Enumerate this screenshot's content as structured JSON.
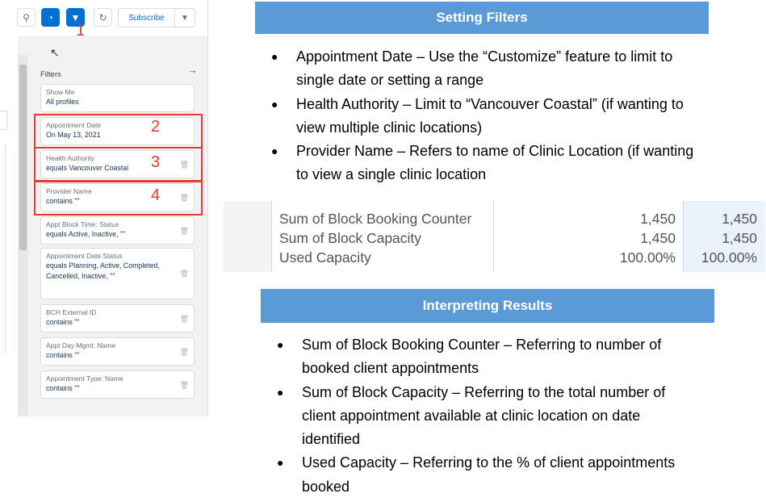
{
  "toolbar": {
    "subscribe_label": "Subscribe",
    "annotation_1": "1"
  },
  "filters_panel": {
    "title": "Filters",
    "cards": [
      {
        "title": "Show Me",
        "value": "All profiles"
      },
      {
        "title": "Appointment Date",
        "value": "On May 13, 2021",
        "annotation": "2"
      },
      {
        "title": "Health Authority",
        "value": "equals Vancouver Coastal",
        "annotation": "3"
      },
      {
        "title": "Provider Name",
        "value": "contains \"\"",
        "annotation": "4"
      },
      {
        "title": "Appt Block Time: Status",
        "value": "equals Active, Inactive, \"\""
      },
      {
        "title": "Appointment Date Status",
        "value": "equals Planning, Active, Completed, Cancelled, Inactive, \"\""
      },
      {
        "title": "BCH External ID",
        "value": "contains \"\""
      },
      {
        "title": "Appt Day Mgmt: Name",
        "value": "contains \"\""
      },
      {
        "title": "Appointment Type: Name",
        "value": "contains \"\""
      }
    ]
  },
  "setting_filters": {
    "heading": "Setting Filters",
    "bullets": [
      "Appointment Date – Use the “Customize” feature to limit to single date or setting a range",
      "Health Authority – Limit to “Vancouver Coastal” (if wanting to view multiple clinic locations)",
      "Provider Name – Refers to name of Clinic Location (if wanting to view a single clinic location"
    ]
  },
  "results_table": {
    "rows": [
      {
        "label": "Sum of Block Booking Counter",
        "value1": "1,450",
        "value2": "1,450"
      },
      {
        "label": "Sum of Block Capacity",
        "value1": "1,450",
        "value2": "1,450"
      },
      {
        "label": "Used Capacity",
        "value1": "100.00%",
        "value2": "100.00%"
      }
    ]
  },
  "interpreting_results": {
    "heading": "Interpreting Results",
    "bullets": [
      "Sum of Block Booking Counter – Referring to number of booked client appointments",
      "Sum of Block Capacity – Referring to the total number of client appointment available at clinic location on date identified",
      "Used Capacity – Referring to the % of client appointments booked"
    ]
  },
  "colors": {
    "header_bar": "#5b9bd5",
    "brand_blue": "#0070d2",
    "annotation_red": "#e53935"
  }
}
